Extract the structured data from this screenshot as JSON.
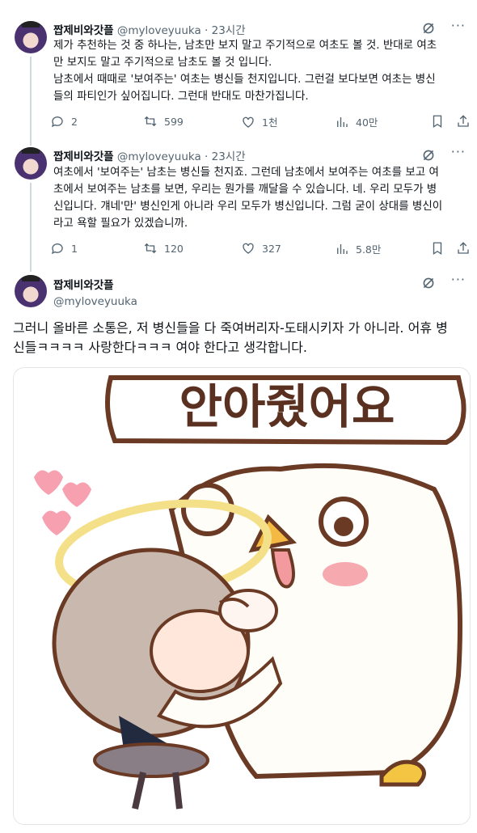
{
  "tweets": [
    {
      "name": "짭제비와갓플",
      "handle": "@myloveyuuka",
      "time": "· 23시간",
      "lines": [
        "제가 추천하는 것 중 하나는, 남초만 보지 말고 주기적으로 여초도 볼 것. 반대로 여초",
        "만 보지도 말고 주기적으로 남초도 볼 것 입니다.",
        "남초에서 때때로 '보여주는' 여초는 병신들 천지입니다. 그런걸 보다보면 여초는 병신",
        "들의 파티인가 싶어집니다. 그런대 반대도 마찬가집니다."
      ],
      "replies": "2",
      "retweets": "599",
      "likes": "1천",
      "views": "40만"
    },
    {
      "name": "짭제비와갓플",
      "handle": "@myloveyuuka",
      "time": "· 23시간",
      "lines": [
        "여초에서 '보여주는' 남초는 병신들 천지죠. 그런데 남초에서 보여주는 여초를 보고 여",
        "초에서 보여주는 남초를 보면, 우리는 뭔가를 깨달을 수 있습니다. 네. 우리 모두가 병",
        "신입니다. 걔네'만' 병신인게 아니라 우리 모두가 병신입니다. 그럼 굳이 상대를 병신이",
        "라고 욕할 필요가 있겠습니까."
      ],
      "replies": "1",
      "retweets": "120",
      "likes": "327",
      "views": "5.8만"
    }
  ],
  "main_tweet": {
    "name": "짭제비와갓플",
    "handle": "@myloveyuuka",
    "lines": [
      "그러니 올바른 소통은, 저 병신들을 다 죽여버리자-도태시키자 가 아니라. 어휴 병",
      "신들ㅋㅋㅋㅋ 사랑한다ㅋㅋㅋ 여야 한다고 생각합니다."
    ],
    "image_text": "안아줬어요"
  },
  "icons": [
    "grok-icon",
    "more-icon",
    "reply-icon",
    "retweet-icon",
    "like-icon",
    "views-icon",
    "bookmark-icon",
    "share-icon"
  ]
}
